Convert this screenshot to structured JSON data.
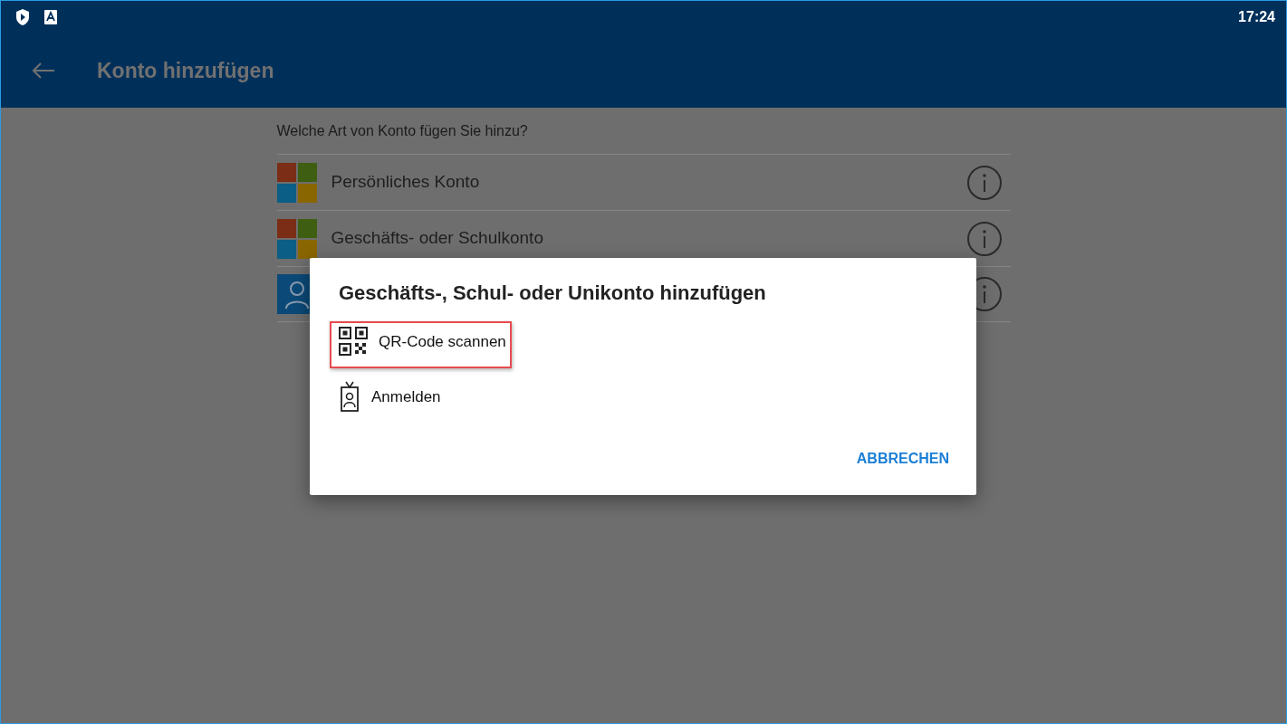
{
  "status_bar": {
    "time": "17:24"
  },
  "app_bar": {
    "title": "Konto hinzufügen"
  },
  "content": {
    "question": "Welche Art von Konto fügen Sie hinzu?",
    "accounts": [
      {
        "kind": "microsoft",
        "label": "Persönliches Konto"
      },
      {
        "kind": "microsoft",
        "label": "Geschäfts- oder Schulkonto"
      },
      {
        "kind": "person"
      }
    ]
  },
  "dialog": {
    "title": "Geschäfts-, Schul- oder Unikonto hinzufügen",
    "options": [
      {
        "kind": "qr",
        "label": "QR-Code scannen",
        "highlighted": true
      },
      {
        "kind": "badge",
        "label": "Anmelden",
        "highlighted": false
      }
    ],
    "buttons": [
      "ABBRECHEN"
    ]
  }
}
